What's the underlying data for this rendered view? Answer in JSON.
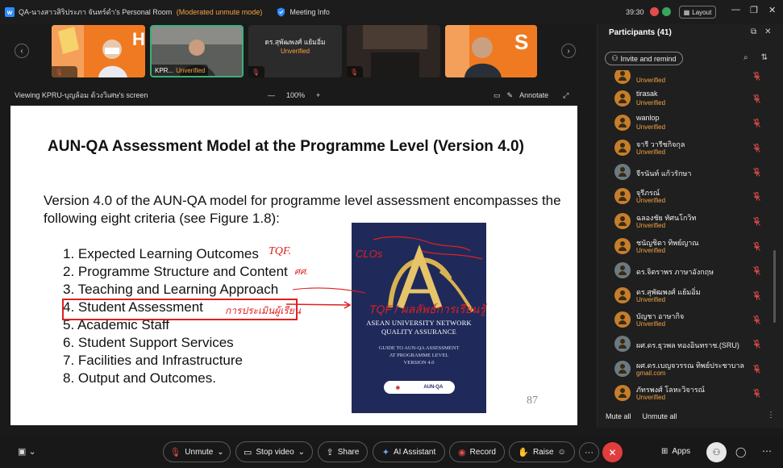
{
  "titlebar": {
    "title": "QA-นางสาวสิริประภา จันทร์ดำ's Personal Room",
    "status": "(Moderated unmute mode)",
    "meeting_info": "Meeting Info",
    "time": "39:30",
    "layout_label": "Layout"
  },
  "tiles": [
    {
      "name": ""
    },
    {
      "name": "KPR...",
      "unverified": "Unverified"
    },
    {
      "name": "ดร.สุพัฒพงศ์ แย้มอิ่ม",
      "unverified": "Unverified"
    },
    {
      "name": ""
    },
    {
      "name": ""
    }
  ],
  "viewbar": {
    "label": "Viewing KPRU-บุญล้อม ด้วงวิเศษ's screen",
    "zoom_minus": "—",
    "zoom": "100%",
    "zoom_plus": "+",
    "annotate": "Annotate"
  },
  "slide": {
    "title": "AUN-QA Assessment Model at the Programme Level (Version 4.0)",
    "intro": "Version 4.0 of the AUN-QA model for programme level assessment encompasses the following eight criteria (see Figure 1.8):",
    "criteria": [
      "1.  Expected Learning Outcomes",
      "2.  Programme Structure and Content",
      "3.  Teaching and Learning Approach",
      "4.  Student Assessment",
      "5.  Academic Staff",
      "6.  Student Support Services",
      "7.  Facilities and Infrastructure",
      "8.  Output and Outcomes."
    ],
    "annotations": {
      "tqf1": "TQF.",
      "short": "ศศ.",
      "clos": "CLOs",
      "assess": "การประเมินผู้เรียน",
      "tqf2": "TQF / ผลลัพธ์การเรียนรู้"
    },
    "book": {
      "org_line1": "ASEAN UNIVERSITY NETWORK",
      "org_line2": "QUALITY ASSURANCE",
      "guide_line1": "GUIDE TO AUN-QA ASSESSMENT",
      "guide_line2": "AT PROGRAMME LEVEL",
      "guide_line3": "VERSION 4.0",
      "logo_text": "AUN-QA"
    },
    "page_number": "87"
  },
  "panel": {
    "title": "Participants (41)",
    "invite": "Invite and remind",
    "mute_all": "Mute all",
    "unmute_all": "Unmute all",
    "participants": [
      {
        "name": "",
        "sub": "Unverified",
        "photo": false
      },
      {
        "name": "tirasak",
        "sub": "Unverified",
        "photo": false
      },
      {
        "name": "wanlop",
        "sub": "Unverified",
        "photo": false
      },
      {
        "name": "จารี  วารีชกิจกุล",
        "sub": "Unverified",
        "photo": false
      },
      {
        "name": "จีรนันท์ แก้วรักษา",
        "sub": "",
        "photo": true
      },
      {
        "name": "จุรีภรณ์",
        "sub": "Unverified",
        "photo": false
      },
      {
        "name": "ฉลองชัย ทัศนโกวิท",
        "sub": "Unverified",
        "photo": false
      },
      {
        "name": "ชนัญชิดา ทิพย์ญาณ",
        "sub": "Unverified",
        "photo": false
      },
      {
        "name": "ดร.จิตราพร ภาษาอังกฤษ",
        "sub": "",
        "photo": true
      },
      {
        "name": "ดร.สุพัฒพงศ์ แย้มอิ่ม",
        "sub": "Unverified",
        "photo": false
      },
      {
        "name": "บัญชา อาษากิจ",
        "sub": "Unverified",
        "photo": false
      },
      {
        "name": "ผศ.ดร.ธุวพล ทองอินทราช.(SRU)",
        "sub": "",
        "photo": true
      },
      {
        "name": "ผศ.ดร.เบญจวรรณ ทิพย์ประชาบาล",
        "sub": "gmail.com",
        "photo": true
      },
      {
        "name": "ภัทรพงศ์ โลหะวิจารณ์",
        "sub": "Unverified",
        "photo": false
      }
    ]
  },
  "toolbar": {
    "unmute": "Unmute",
    "stop_video": "Stop video",
    "share": "Share",
    "ai_assistant": "AI Assistant",
    "record": "Record",
    "raise": "Raise",
    "more": "···",
    "apps": "Apps"
  },
  "colors": {
    "accent_orange": "#f4a340",
    "leave_red": "#e03e3e",
    "annotation_red": "#e02020",
    "book_blue": "#1f2a5a",
    "tile_orange": "#f07a22"
  }
}
